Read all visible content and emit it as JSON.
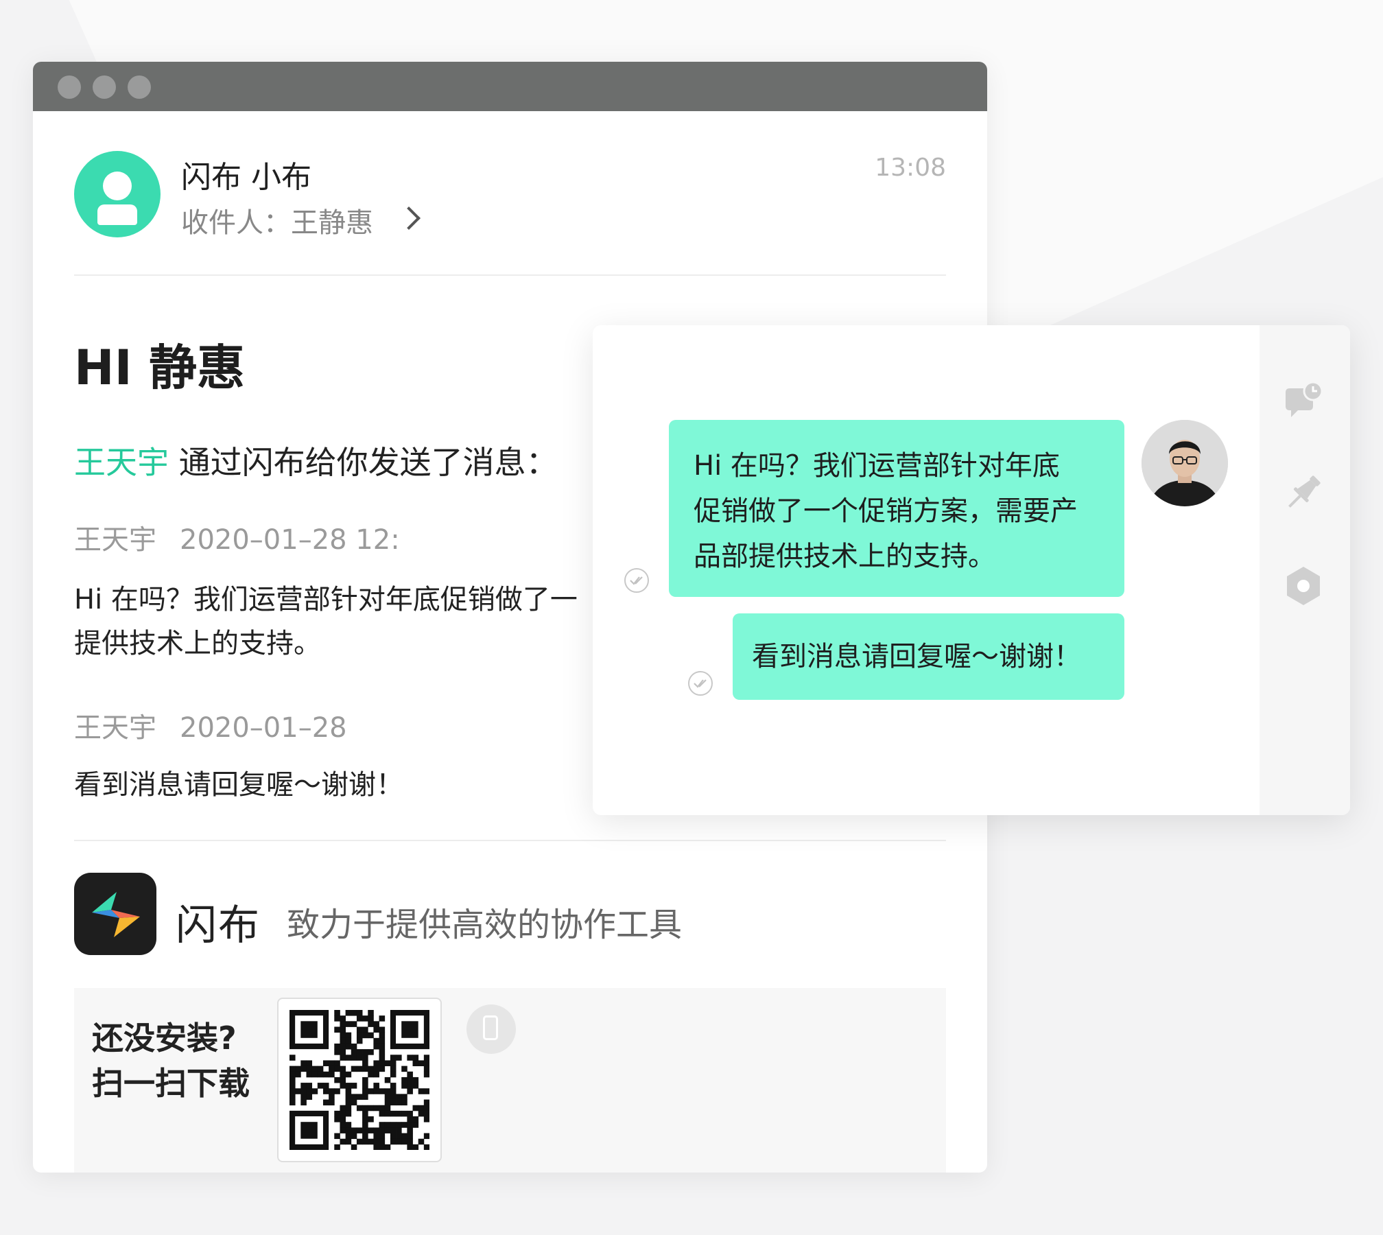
{
  "email": {
    "sender_name": "闪布 小布",
    "recipient_label": "收件人：王静惠",
    "time": "13:08",
    "greeting": "HI 静惠",
    "intro_highlight": "王天宇",
    "intro_rest": " 通过闪布给你发送了消息：",
    "messages": [
      {
        "author": "王天宇",
        "timestamp": "2020–01–28 12:",
        "lines": [
          "Hi 在吗？我们运营部针对年底促销做了一",
          "提供技术上的支持。"
        ]
      },
      {
        "author": "王天宇",
        "timestamp": "2020–01–28",
        "lines": [
          "看到消息请回复喔～谢谢！"
        ]
      }
    ],
    "footer": {
      "brand_name": "闪布",
      "slogan": "致力于提供高效的协作工具",
      "install_line1": "还没安装?",
      "install_line2": "扫一扫下载"
    }
  },
  "chat": {
    "bubble1_lines": [
      "Hi 在吗？我们运营部针对年底",
      "促销做了一个促销方案，需要产",
      "品部提供技术上的支持。"
    ],
    "bubble2": "看到消息请回复喔～谢谢！",
    "sidebar_icons": [
      "chat-history-icon",
      "pin-icon",
      "settings-icon"
    ]
  },
  "colors": {
    "accent": "#3bdbb0",
    "highlight_text": "#25c99b",
    "bubble": "#7ff8d7",
    "titlebar": "#6c6e6d"
  }
}
